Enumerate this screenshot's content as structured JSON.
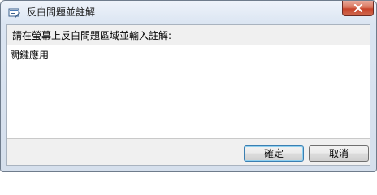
{
  "window": {
    "title": "反白問題並註解",
    "icon": "snipping-pen-icon"
  },
  "dialog": {
    "prompt": "請在螢幕上反白問題區域並輸入註解:",
    "comment_value": "關鍵應用"
  },
  "buttons": {
    "ok_label": "確定",
    "cancel_label": "取消"
  },
  "colors": {
    "close_button": "#c7432a",
    "default_button_border": "#3c7fb1"
  }
}
